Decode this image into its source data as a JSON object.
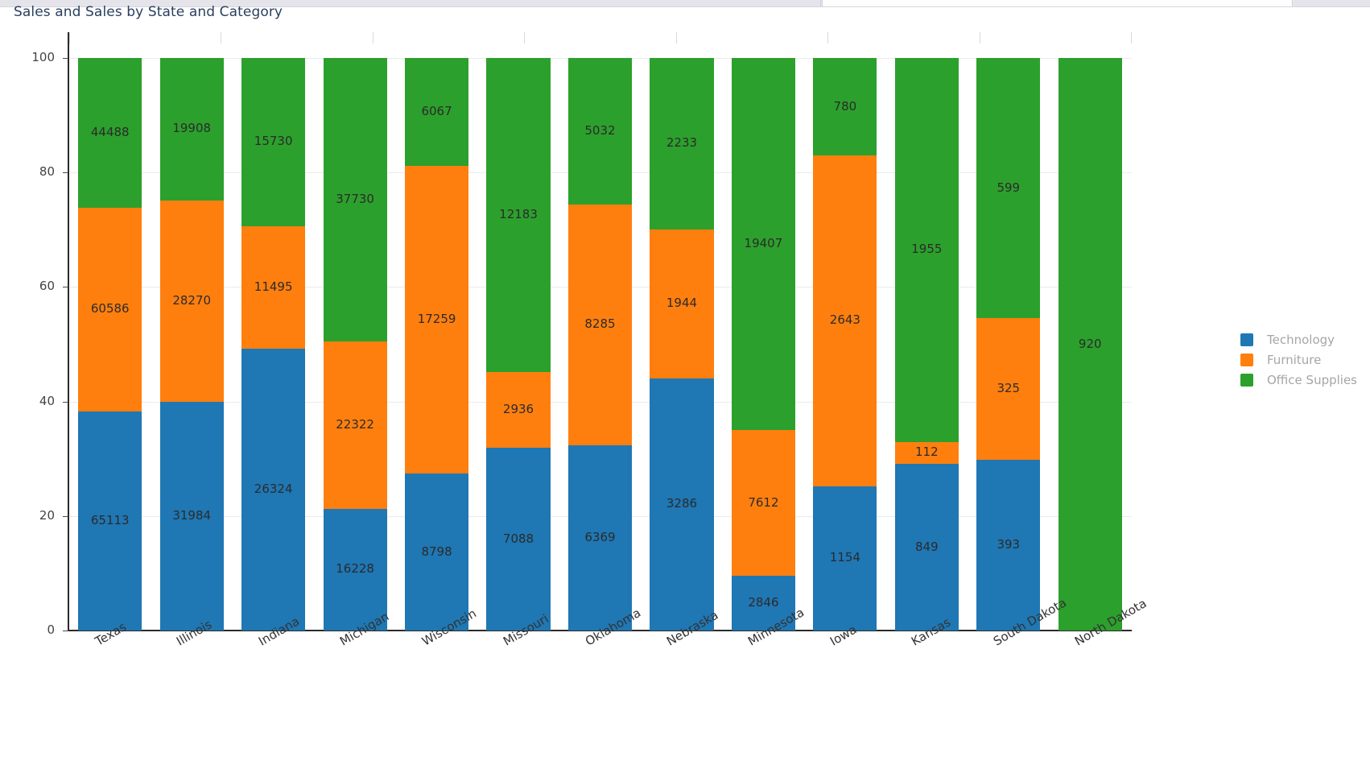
{
  "window": {
    "chrome_visible": true
  },
  "chart": {
    "title": "Sales and Sales by State and Category",
    "title_color": "#2a3f5f"
  },
  "legend": {
    "position": "right",
    "items": [
      {
        "label": "Technology",
        "color": "#1f77b4"
      },
      {
        "label": "Furniture",
        "color": "#ff7f0e"
      },
      {
        "label": "Office Supplies",
        "color": "#2ca02c"
      }
    ]
  },
  "yaxis": {
    "ticks": [
      "0",
      "20",
      "40",
      "60",
      "80",
      "100"
    ],
    "values": [
      0,
      20,
      40,
      60,
      80,
      100
    ]
  },
  "chart_data": {
    "type": "bar",
    "barmode": "stacked-percent",
    "title": "Sales and Sales by State and Category",
    "xlabel": "",
    "ylabel": "",
    "ylim": [
      0,
      100
    ],
    "grid": true,
    "legend_position": "right",
    "categories": [
      "Texas",
      "Illinois",
      "Indiana",
      "Michigan",
      "Wisconsin",
      "Missouri",
      "Oklahoma",
      "Nebraska",
      "Minnesota",
      "Iowa",
      "Kansas",
      "South Dakota",
      "North Dakota"
    ],
    "series": [
      {
        "name": "Technology",
        "color": "#1f77b4",
        "values": [
          65113,
          31984,
          26324,
          16228,
          8798,
          7088,
          6369,
          3286,
          2846,
          1154,
          849,
          393,
          0
        ]
      },
      {
        "name": "Furniture",
        "color": "#ff7f0e",
        "values": [
          60586,
          28270,
          11495,
          22322,
          17259,
          2936,
          8285,
          1944,
          7612,
          2643,
          112,
          325,
          0
        ]
      },
      {
        "name": "Office Supplies",
        "color": "#2ca02c",
        "values": [
          44488,
          19908,
          15730,
          37730,
          6067,
          12183,
          5032,
          2233,
          19407,
          780,
          1955,
          599,
          920
        ]
      }
    ]
  }
}
